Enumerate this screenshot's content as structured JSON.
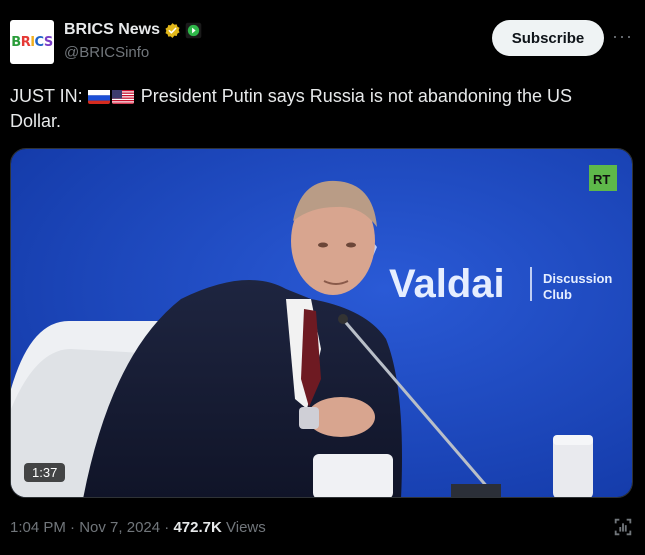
{
  "account": {
    "avatar_text": "BRICS",
    "display_name": "BRICS News",
    "handle": "@BRICSinfo",
    "verified_icon": "gold-verified-badge-icon",
    "affiliate_icon": "green-affiliate-icon"
  },
  "actions": {
    "subscribe_label": "Subscribe",
    "more_label": "···"
  },
  "tweet": {
    "prefix": "JUST IN:",
    "flags": [
      "russia-flag-icon",
      "us-flag-icon"
    ],
    "body": "President Putin says Russia is not abandoning the US Dollar."
  },
  "media": {
    "channel_logo": "RT",
    "backdrop_title": "Valdai",
    "backdrop_subtitle_1": "Discussion",
    "backdrop_subtitle_2": "Club",
    "duration": "1:37"
  },
  "meta": {
    "time": "1:04 PM",
    "date": "Nov 7, 2024",
    "views_count": "472.7K",
    "views_label": "Views"
  },
  "colors": {
    "background": "#000000",
    "text": "#e7e9ea",
    "muted": "#71767b",
    "stage_blue": "#1a43b8"
  }
}
